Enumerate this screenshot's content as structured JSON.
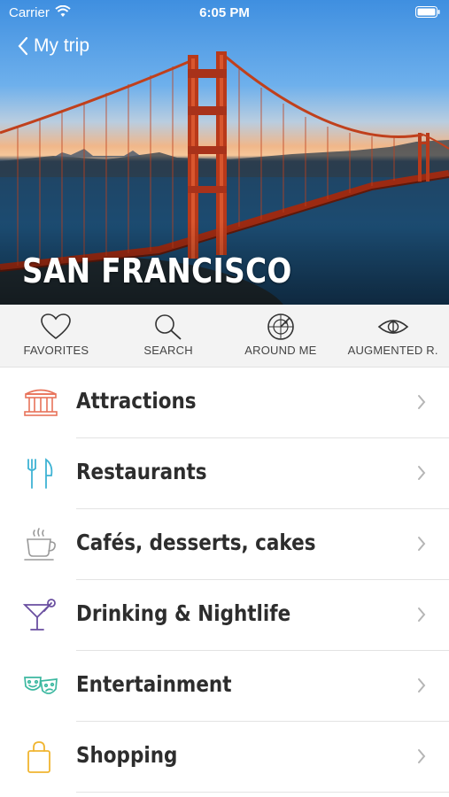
{
  "status_bar": {
    "carrier": "Carrier",
    "time": "6:05 PM"
  },
  "header": {
    "back_label": "My trip",
    "city": "SAN FRANCISCO"
  },
  "toolbar": [
    {
      "label": "FAVORITES",
      "icon": "heart-icon"
    },
    {
      "label": "SEARCH",
      "icon": "magnifier-icon"
    },
    {
      "label": "AROUND ME",
      "icon": "radar-icon"
    },
    {
      "label": "AUGMENTED R.",
      "icon": "eye-icon"
    }
  ],
  "categories": [
    {
      "label": "Attractions",
      "icon": "temple-icon",
      "color": "#e8735a"
    },
    {
      "label": "Restaurants",
      "icon": "fork-knife-icon",
      "color": "#3eb3d4"
    },
    {
      "label": "Cafés, desserts, cakes",
      "icon": "coffee-cup-icon",
      "color": "#9a9a9a"
    },
    {
      "label": "Drinking & Nightlife",
      "icon": "cocktail-icon",
      "color": "#6a4fa0"
    },
    {
      "label": "Entertainment",
      "icon": "theater-masks-icon",
      "color": "#3cb8a0"
    },
    {
      "label": "Shopping",
      "icon": "shopping-bag-icon",
      "color": "#f0b530"
    }
  ]
}
